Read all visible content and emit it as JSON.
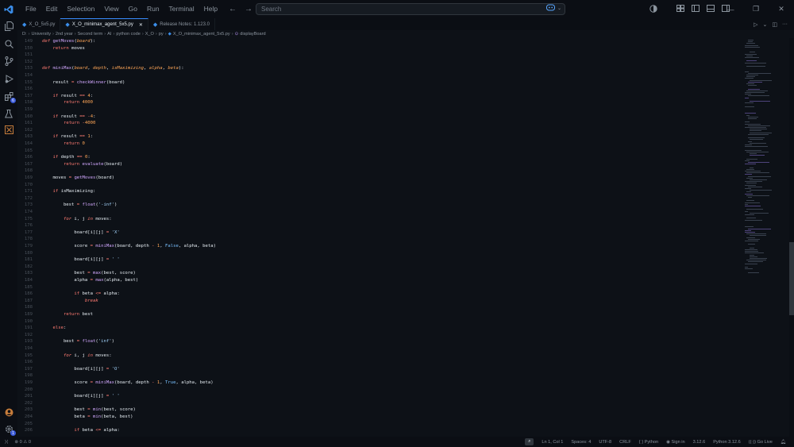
{
  "menu": [
    "File",
    "Edit",
    "Selection",
    "View",
    "Go",
    "Run",
    "Terminal",
    "Help"
  ],
  "search": {
    "placeholder": "Search"
  },
  "tabs": [
    {
      "label": "X_O_5x5.py"
    },
    {
      "label": "X_O_minimax_agent_5x5.py"
    },
    {
      "label": "Release Notes: 1.123.0"
    }
  ],
  "breadcrumb": [
    "D:",
    "University",
    "2nd year",
    "Second term",
    "AI",
    "python code",
    "X_O",
    "py",
    "X_O_minimax_agent_5x5.py",
    "displayBoard"
  ],
  "activity_badges": {
    "extensions": "6"
  },
  "editor": {
    "lines": [
      {
        "n": "149",
        "code": [
          [
            "kw",
            "def "
          ],
          [
            "fn",
            "getMoves"
          ],
          [
            "plain",
            "("
          ],
          [
            "param",
            "board"
          ],
          [
            "plain",
            "):"
          ]
        ]
      },
      {
        "n": "150",
        "code": [
          [
            "plain",
            "    "
          ],
          [
            "ctrl",
            "return"
          ],
          [
            "plain",
            " moves"
          ]
        ]
      },
      {
        "n": "151",
        "code": []
      },
      {
        "n": "152",
        "code": []
      },
      {
        "n": "153",
        "code": [
          [
            "kw",
            "def "
          ],
          [
            "fn",
            "miniMax"
          ],
          [
            "plain",
            "("
          ],
          [
            "param",
            "board"
          ],
          [
            "plain",
            ", "
          ],
          [
            "param",
            "depth"
          ],
          [
            "plain",
            ", "
          ],
          [
            "param",
            "isMaximizing"
          ],
          [
            "plain",
            ", "
          ],
          [
            "param",
            "alpha"
          ],
          [
            "plain",
            ", "
          ],
          [
            "param",
            "beta"
          ],
          [
            "plain",
            "):"
          ]
        ]
      },
      {
        "n": "154",
        "code": []
      },
      {
        "n": "155",
        "code": [
          [
            "plain",
            "    result "
          ],
          [
            "op",
            "="
          ],
          [
            "plain",
            " "
          ],
          [
            "fn",
            "checkWinner"
          ],
          [
            "plain",
            "(board)"
          ]
        ]
      },
      {
        "n": "156",
        "code": []
      },
      {
        "n": "157",
        "code": [
          [
            "plain",
            "    "
          ],
          [
            "ctrl",
            "if"
          ],
          [
            "plain",
            " result "
          ],
          [
            "op",
            "=="
          ],
          [
            "plain",
            " "
          ],
          [
            "num",
            "4"
          ],
          [
            "plain",
            ":"
          ]
        ]
      },
      {
        "n": "158",
        "code": [
          [
            "plain",
            "        "
          ],
          [
            "ctrl",
            "return"
          ],
          [
            "plain",
            " "
          ],
          [
            "num",
            "4000"
          ]
        ]
      },
      {
        "n": "159",
        "code": []
      },
      {
        "n": "160",
        "code": [
          [
            "plain",
            "    "
          ],
          [
            "ctrl",
            "if"
          ],
          [
            "plain",
            " result "
          ],
          [
            "op",
            "=="
          ],
          [
            "plain",
            " "
          ],
          [
            "op",
            "-"
          ],
          [
            "num",
            "4"
          ],
          [
            "plain",
            ":"
          ]
        ]
      },
      {
        "n": "161",
        "code": [
          [
            "plain",
            "        "
          ],
          [
            "ctrl",
            "return"
          ],
          [
            "plain",
            " "
          ],
          [
            "op",
            "-"
          ],
          [
            "num",
            "4000"
          ]
        ]
      },
      {
        "n": "162",
        "code": []
      },
      {
        "n": "163",
        "code": [
          [
            "plain",
            "    "
          ],
          [
            "ctrl",
            "if"
          ],
          [
            "plain",
            " result "
          ],
          [
            "op",
            "=="
          ],
          [
            "plain",
            " "
          ],
          [
            "num",
            "1"
          ],
          [
            "plain",
            ":"
          ]
        ]
      },
      {
        "n": "164",
        "code": [
          [
            "plain",
            "        "
          ],
          [
            "ctrl",
            "return"
          ],
          [
            "plain",
            " "
          ],
          [
            "num",
            "0"
          ]
        ]
      },
      {
        "n": "165",
        "code": []
      },
      {
        "n": "166",
        "code": [
          [
            "plain",
            "    "
          ],
          [
            "ctrl",
            "if"
          ],
          [
            "plain",
            " depth "
          ],
          [
            "op",
            "=="
          ],
          [
            "plain",
            " "
          ],
          [
            "num",
            "0"
          ],
          [
            "plain",
            ":"
          ]
        ]
      },
      {
        "n": "167",
        "code": [
          [
            "plain",
            "        "
          ],
          [
            "ctrl",
            "return"
          ],
          [
            "plain",
            " "
          ],
          [
            "fn",
            "evaluate"
          ],
          [
            "plain",
            "(board)"
          ]
        ]
      },
      {
        "n": "168",
        "code": []
      },
      {
        "n": "169",
        "code": [
          [
            "plain",
            "    moves "
          ],
          [
            "op",
            "="
          ],
          [
            "plain",
            " "
          ],
          [
            "fn",
            "getMoves"
          ],
          [
            "plain",
            "(board)"
          ]
        ]
      },
      {
        "n": "170",
        "code": []
      },
      {
        "n": "171",
        "code": [
          [
            "plain",
            "    "
          ],
          [
            "ctrl",
            "if"
          ],
          [
            "plain",
            " isMaximizing:"
          ]
        ]
      },
      {
        "n": "172",
        "code": []
      },
      {
        "n": "173",
        "code": [
          [
            "plain",
            "        best "
          ],
          [
            "op",
            "="
          ],
          [
            "plain",
            " "
          ],
          [
            "fn",
            "float"
          ],
          [
            "plain",
            "("
          ],
          [
            "str",
            "'-inf'"
          ],
          [
            "plain",
            ")"
          ]
        ]
      },
      {
        "n": "174",
        "code": []
      },
      {
        "n": "175",
        "code": [
          [
            "plain",
            "        "
          ],
          [
            "kw",
            "for"
          ],
          [
            "plain",
            " i, j "
          ],
          [
            "kw",
            "in"
          ],
          [
            "plain",
            " moves:"
          ]
        ]
      },
      {
        "n": "176",
        "code": []
      },
      {
        "n": "177",
        "code": [
          [
            "plain",
            "            board[i][j] "
          ],
          [
            "op",
            "="
          ],
          [
            "plain",
            " "
          ],
          [
            "str",
            "'X'"
          ]
        ]
      },
      {
        "n": "178",
        "code": []
      },
      {
        "n": "179",
        "code": [
          [
            "plain",
            "            score "
          ],
          [
            "op",
            "="
          ],
          [
            "plain",
            " "
          ],
          [
            "fn",
            "miniMax"
          ],
          [
            "plain",
            "(board, depth "
          ],
          [
            "op",
            "-"
          ],
          [
            "plain",
            " "
          ],
          [
            "num",
            "1"
          ],
          [
            "plain",
            ", "
          ],
          [
            "bool",
            "False"
          ],
          [
            "plain",
            ", alpha, beta)"
          ]
        ]
      },
      {
        "n": "180",
        "code": []
      },
      {
        "n": "181",
        "code": [
          [
            "plain",
            "            board[i][j] "
          ],
          [
            "op",
            "="
          ],
          [
            "plain",
            " "
          ],
          [
            "str",
            "' '"
          ]
        ]
      },
      {
        "n": "182",
        "code": []
      },
      {
        "n": "183",
        "code": [
          [
            "plain",
            "            best "
          ],
          [
            "op",
            "="
          ],
          [
            "plain",
            " "
          ],
          [
            "fn",
            "max"
          ],
          [
            "plain",
            "(best, score)"
          ]
        ]
      },
      {
        "n": "184",
        "code": [
          [
            "plain",
            "            alpha "
          ],
          [
            "op",
            "="
          ],
          [
            "plain",
            " "
          ],
          [
            "fn",
            "max"
          ],
          [
            "plain",
            "(alpha, best)"
          ]
        ]
      },
      {
        "n": "185",
        "code": []
      },
      {
        "n": "186",
        "code": [
          [
            "plain",
            "            "
          ],
          [
            "ctrl",
            "if"
          ],
          [
            "plain",
            " beta "
          ],
          [
            "op",
            "<="
          ],
          [
            "plain",
            " alpha:"
          ]
        ]
      },
      {
        "n": "187",
        "code": [
          [
            "plain",
            "                "
          ],
          [
            "kw",
            "break"
          ]
        ]
      },
      {
        "n": "188",
        "code": []
      },
      {
        "n": "189",
        "code": [
          [
            "plain",
            "        "
          ],
          [
            "ctrl",
            "return"
          ],
          [
            "plain",
            " best"
          ]
        ]
      },
      {
        "n": "190",
        "code": []
      },
      {
        "n": "191",
        "code": [
          [
            "plain",
            "    "
          ],
          [
            "ctrl",
            "else"
          ],
          [
            "plain",
            ":"
          ]
        ]
      },
      {
        "n": "192",
        "code": []
      },
      {
        "n": "193",
        "code": [
          [
            "plain",
            "        best "
          ],
          [
            "op",
            "="
          ],
          [
            "plain",
            " "
          ],
          [
            "fn",
            "float"
          ],
          [
            "plain",
            "("
          ],
          [
            "str",
            "'inf'"
          ],
          [
            "plain",
            ")"
          ]
        ]
      },
      {
        "n": "194",
        "code": []
      },
      {
        "n": "195",
        "code": [
          [
            "plain",
            "        "
          ],
          [
            "kw",
            "for"
          ],
          [
            "plain",
            " i, j "
          ],
          [
            "kw",
            "in"
          ],
          [
            "plain",
            " moves:"
          ]
        ]
      },
      {
        "n": "196",
        "code": []
      },
      {
        "n": "197",
        "code": [
          [
            "plain",
            "            board[i][j] "
          ],
          [
            "op",
            "="
          ],
          [
            "plain",
            " "
          ],
          [
            "str",
            "'O'"
          ]
        ]
      },
      {
        "n": "198",
        "code": []
      },
      {
        "n": "199",
        "code": [
          [
            "plain",
            "            score "
          ],
          [
            "op",
            "="
          ],
          [
            "plain",
            " "
          ],
          [
            "fn",
            "miniMax"
          ],
          [
            "plain",
            "(board, depth "
          ],
          [
            "op",
            "-"
          ],
          [
            "plain",
            " "
          ],
          [
            "num",
            "1"
          ],
          [
            "plain",
            ", "
          ],
          [
            "bool",
            "True"
          ],
          [
            "plain",
            ", alpha, beta)"
          ]
        ]
      },
      {
        "n": "200",
        "code": []
      },
      {
        "n": "201",
        "code": [
          [
            "plain",
            "            board[i][j] "
          ],
          [
            "op",
            "="
          ],
          [
            "plain",
            " "
          ],
          [
            "str",
            "' '"
          ]
        ]
      },
      {
        "n": "202",
        "code": []
      },
      {
        "n": "203",
        "code": [
          [
            "plain",
            "            best "
          ],
          [
            "op",
            "="
          ],
          [
            "plain",
            " "
          ],
          [
            "fn",
            "min"
          ],
          [
            "plain",
            "(best, score)"
          ]
        ]
      },
      {
        "n": "204",
        "code": [
          [
            "plain",
            "            beta "
          ],
          [
            "op",
            "="
          ],
          [
            "plain",
            " "
          ],
          [
            "fn",
            "min"
          ],
          [
            "plain",
            "(beta, best)"
          ]
        ]
      },
      {
        "n": "205",
        "code": []
      },
      {
        "n": "206",
        "code": [
          [
            "plain",
            "            "
          ],
          [
            "ctrl",
            "if"
          ],
          [
            "plain",
            " beta "
          ],
          [
            "op",
            "<="
          ],
          [
            "plain",
            " alpha:"
          ]
        ]
      }
    ]
  },
  "status": {
    "errors": "0",
    "warnings": "0",
    "position": "Ln 1, Col 1",
    "spaces": "Spaces: 4",
    "encoding": "UTF-8",
    "eol": "CRLF",
    "language": "Python",
    "signin": "Sign in",
    "version": "3.12.6",
    "interpreter": "Python 3.12.6",
    "golive": "Go Live"
  }
}
